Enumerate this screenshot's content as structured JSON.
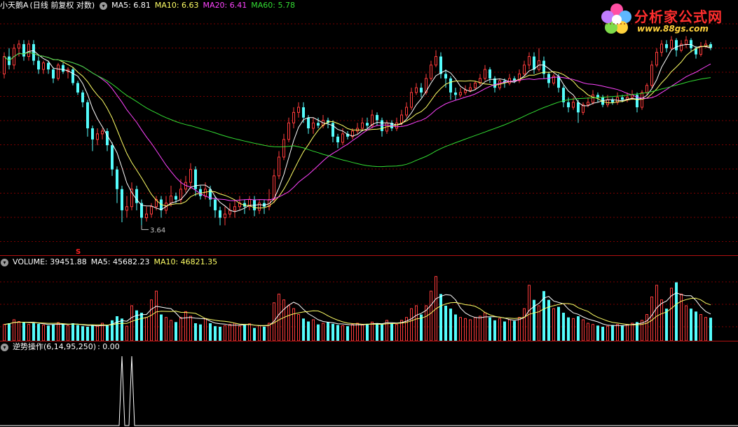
{
  "main_header": {
    "name": "小天鹅A",
    "mode": "(日线 前复权 对数)",
    "ma5": "MA5: 6.81",
    "ma10": "MA10: 6.63",
    "ma20": "MA20: 6.41",
    "ma60": "MA60: 5.78"
  },
  "volume_header": {
    "volume": "VOLUME: 39451.88",
    "ma5": "MA5: 45682.23",
    "ma10": "MA10: 46821.35"
  },
  "indicator_header": {
    "label": "逆势操作(6,14,95,250)",
    "value": ": 0.00"
  },
  "annotations": {
    "low_label": "3.64",
    "signal_mark": "S"
  },
  "logo": {
    "title": "分析家公式网",
    "url": "www.88gs.com"
  },
  "colors": {
    "up": "#ff3b3b",
    "down": "#54fcfc",
    "ma5": "#ffffff",
    "ma10": "#ffff66",
    "ma20": "#ff44ff",
    "ma60": "#33dd33",
    "grid": "#7a0000",
    "indicator": "#ffffff"
  },
  "chart_data": [
    {
      "type": "candlestick",
      "title": "小天鹅A (日线 前复权 对数)",
      "scale": "log",
      "ylim": [
        3.3,
        7.2
      ],
      "grid": true,
      "series_labels": [
        "MA5",
        "MA10",
        "MA20",
        "MA60"
      ],
      "last_values": {
        "MA5": 6.81,
        "MA10": 6.63,
        "MA20": 6.41,
        "MA60": 5.78
      },
      "annotated_low": 3.64,
      "candles": [
        [
          6.2,
          6.6,
          6.7,
          6.1
        ],
        [
          6.6,
          6.4,
          6.8,
          6.3
        ],
        [
          6.4,
          6.8,
          6.9,
          6.3
        ],
        [
          6.8,
          6.9,
          7.0,
          6.6
        ],
        [
          6.9,
          6.6,
          7.0,
          6.5
        ],
        [
          6.6,
          6.9,
          7.0,
          6.5
        ],
        [
          6.9,
          6.5,
          7.0,
          6.4
        ],
        [
          6.5,
          6.3,
          6.6,
          6.2
        ],
        [
          6.3,
          6.45,
          6.5,
          6.2
        ],
        [
          6.45,
          6.3,
          6.5,
          6.2
        ],
        [
          6.3,
          6.1,
          6.35,
          6.0
        ],
        [
          6.1,
          6.4,
          6.45,
          6.05
        ],
        [
          6.4,
          6.25,
          6.45,
          6.2
        ],
        [
          6.25,
          6.3,
          6.35,
          6.1
        ],
        [
          6.3,
          6.0,
          6.35,
          5.95
        ],
        [
          6.0,
          5.8,
          6.05,
          5.75
        ],
        [
          5.8,
          5.6,
          5.85,
          5.5
        ],
        [
          5.6,
          5.1,
          5.65,
          4.95
        ],
        [
          5.1,
          4.9,
          5.15,
          4.7
        ],
        [
          4.9,
          5.0,
          5.1,
          4.8
        ],
        [
          5.0,
          5.05,
          5.1,
          4.9
        ],
        [
          5.05,
          4.8,
          5.1,
          4.7
        ],
        [
          4.8,
          4.4,
          4.85,
          4.3
        ],
        [
          4.4,
          4.1,
          4.45,
          3.9
        ],
        [
          4.1,
          3.8,
          4.15,
          3.64
        ],
        [
          3.8,
          3.85,
          4.0,
          3.7
        ],
        [
          3.85,
          4.1,
          4.2,
          3.8
        ],
        [
          4.1,
          3.9,
          4.15,
          3.8
        ],
        [
          3.9,
          3.7,
          3.95,
          3.6
        ],
        [
          3.7,
          3.75,
          3.85,
          3.65
        ],
        [
          3.75,
          3.85,
          3.9,
          3.7
        ],
        [
          3.85,
          3.95,
          4.0,
          3.8
        ],
        [
          3.95,
          3.8,
          4.0,
          3.7
        ],
        [
          3.8,
          3.9,
          4.0,
          3.75
        ],
        [
          3.9,
          4.0,
          4.15,
          3.85
        ],
        [
          4.0,
          3.95,
          4.05,
          3.9
        ],
        [
          3.95,
          4.1,
          4.25,
          3.9
        ],
        [
          4.1,
          4.2,
          4.3,
          4.05
        ],
        [
          4.2,
          4.4,
          4.5,
          4.1
        ],
        [
          4.4,
          4.1,
          4.45,
          4.0
        ],
        [
          4.1,
          4.0,
          4.15,
          3.95
        ],
        [
          4.0,
          4.1,
          4.2,
          3.95
        ],
        [
          4.1,
          3.95,
          4.15,
          3.85
        ],
        [
          3.95,
          3.8,
          4.0,
          3.7
        ],
        [
          3.8,
          3.7,
          3.85,
          3.6
        ],
        [
          3.7,
          3.75,
          3.85,
          3.6
        ],
        [
          3.75,
          3.8,
          3.9,
          3.7
        ],
        [
          3.8,
          3.85,
          3.95,
          3.7
        ],
        [
          3.85,
          3.9,
          4.0,
          3.8
        ],
        [
          3.9,
          3.85,
          3.95,
          3.75
        ],
        [
          3.85,
          3.95,
          4.0,
          3.8
        ],
        [
          3.95,
          3.8,
          4.0,
          3.72
        ],
        [
          3.8,
          3.9,
          3.95,
          3.75
        ],
        [
          3.9,
          3.85,
          3.95,
          3.75
        ],
        [
          3.85,
          3.95,
          4.1,
          3.8
        ],
        [
          3.95,
          4.3,
          4.4,
          3.9
        ],
        [
          4.3,
          4.6,
          4.7,
          4.25
        ],
        [
          4.6,
          4.9,
          5.0,
          4.55
        ],
        [
          4.9,
          5.2,
          5.3,
          4.85
        ],
        [
          5.2,
          5.4,
          5.5,
          5.1
        ],
        [
          5.4,
          5.5,
          5.6,
          5.3
        ],
        [
          5.5,
          5.3,
          5.6,
          5.2
        ],
        [
          5.3,
          5.1,
          5.35,
          5.0
        ],
        [
          5.1,
          5.2,
          5.3,
          5.0
        ],
        [
          5.2,
          5.15,
          5.3,
          5.1
        ],
        [
          5.15,
          5.25,
          5.35,
          5.1
        ],
        [
          5.25,
          5.2,
          5.3,
          5.1
        ],
        [
          5.2,
          4.95,
          5.25,
          4.85
        ],
        [
          4.95,
          4.85,
          5.0,
          4.75
        ],
        [
          4.85,
          5.0,
          5.1,
          4.8
        ],
        [
          5.0,
          4.95,
          5.05,
          4.9
        ],
        [
          4.95,
          5.05,
          5.1,
          4.9
        ],
        [
          5.05,
          5.1,
          5.2,
          5.0
        ],
        [
          5.1,
          5.2,
          5.3,
          5.05
        ],
        [
          5.2,
          5.15,
          5.3,
          5.1
        ],
        [
          5.15,
          5.35,
          5.45,
          5.1
        ],
        [
          5.35,
          5.25,
          5.4,
          5.15
        ],
        [
          5.25,
          5.05,
          5.3,
          4.95
        ],
        [
          5.05,
          5.2,
          5.25,
          5.0
        ],
        [
          5.2,
          5.1,
          5.25,
          5.05
        ],
        [
          5.1,
          5.2,
          5.3,
          5.05
        ],
        [
          5.2,
          5.35,
          5.45,
          5.15
        ],
        [
          5.35,
          5.5,
          5.6,
          5.3
        ],
        [
          5.5,
          5.8,
          5.9,
          5.45
        ],
        [
          5.8,
          5.9,
          6.0,
          5.75
        ],
        [
          5.9,
          5.8,
          6.0,
          5.7
        ],
        [
          5.8,
          6.1,
          6.2,
          5.75
        ],
        [
          6.1,
          6.4,
          6.5,
          6.05
        ],
        [
          6.4,
          6.6,
          6.75,
          6.35
        ],
        [
          6.6,
          6.2,
          6.7,
          6.1
        ],
        [
          6.2,
          6.1,
          6.3,
          5.9
        ],
        [
          6.1,
          5.8,
          6.15,
          5.65
        ],
        [
          5.8,
          5.75,
          5.9,
          5.65
        ],
        [
          5.75,
          5.8,
          5.9,
          5.7
        ],
        [
          5.8,
          5.85,
          5.95,
          5.75
        ],
        [
          5.85,
          5.9,
          6.0,
          5.8
        ],
        [
          5.9,
          6.0,
          6.05,
          5.85
        ],
        [
          6.0,
          6.1,
          6.2,
          5.95
        ],
        [
          6.1,
          6.3,
          6.4,
          6.05
        ],
        [
          6.3,
          6.1,
          6.35,
          6.0
        ],
        [
          6.1,
          5.9,
          6.15,
          5.8
        ],
        [
          5.9,
          6.05,
          6.1,
          5.85
        ],
        [
          6.05,
          6.0,
          6.1,
          5.9
        ],
        [
          6.0,
          6.1,
          6.2,
          5.95
        ],
        [
          6.1,
          6.05,
          6.15,
          6.0
        ],
        [
          6.05,
          6.2,
          6.3,
          6.0
        ],
        [
          6.2,
          6.4,
          6.5,
          6.15
        ],
        [
          6.4,
          6.6,
          6.7,
          6.3
        ],
        [
          6.6,
          6.3,
          6.7,
          6.2
        ],
        [
          6.3,
          6.5,
          6.8,
          6.25
        ],
        [
          6.5,
          6.2,
          6.6,
          6.1
        ],
        [
          6.2,
          6.0,
          6.25,
          5.9
        ],
        [
          6.0,
          6.15,
          6.2,
          5.95
        ],
        [
          6.15,
          5.9,
          6.2,
          5.8
        ],
        [
          5.9,
          5.6,
          5.95,
          5.5
        ],
        [
          5.6,
          5.5,
          5.7,
          5.4
        ],
        [
          5.5,
          5.6,
          5.7,
          5.45
        ],
        [
          5.6,
          5.4,
          5.65,
          5.2
        ],
        [
          5.4,
          5.55,
          5.6,
          5.35
        ],
        [
          5.55,
          5.6,
          5.7,
          5.5
        ],
        [
          5.6,
          5.75,
          5.85,
          5.55
        ],
        [
          5.75,
          5.7,
          5.8,
          5.6
        ],
        [
          5.7,
          5.55,
          5.75,
          5.5
        ],
        [
          5.55,
          5.65,
          5.75,
          5.5
        ],
        [
          5.65,
          5.6,
          5.7,
          5.55
        ],
        [
          5.6,
          5.7,
          5.8,
          5.55
        ],
        [
          5.7,
          5.65,
          5.75,
          5.6
        ],
        [
          5.65,
          5.7,
          5.8,
          5.6
        ],
        [
          5.7,
          5.75,
          5.85,
          5.65
        ],
        [
          5.75,
          5.5,
          5.8,
          5.4
        ],
        [
          5.5,
          5.8,
          5.85,
          5.45
        ],
        [
          5.8,
          5.95,
          6.0,
          5.75
        ],
        [
          5.95,
          6.4,
          6.5,
          5.9
        ],
        [
          6.4,
          6.7,
          6.8,
          6.35
        ],
        [
          6.7,
          6.9,
          7.0,
          6.6
        ],
        [
          6.9,
          6.8,
          7.0,
          6.7
        ],
        [
          6.8,
          7.0,
          7.1,
          6.75
        ],
        [
          7.0,
          6.75,
          7.05,
          6.6
        ],
        [
          6.75,
          6.9,
          7.0,
          6.7
        ],
        [
          6.9,
          7.0,
          7.1,
          6.8
        ],
        [
          7.0,
          6.8,
          7.05,
          6.7
        ],
        [
          6.8,
          6.65,
          6.85,
          6.55
        ],
        [
          6.65,
          6.85,
          6.95,
          6.6
        ],
        [
          6.85,
          6.9,
          7.0,
          6.8
        ],
        [
          6.9,
          6.81,
          6.95,
          6.75
        ]
      ]
    },
    {
      "type": "bar",
      "title": "VOLUME",
      "series_labels": [
        "VOLUME",
        "MA5",
        "MA10"
      ],
      "last_values": {
        "VOLUME": 39451.88,
        "MA5": 45682.23,
        "MA10": 46821.35
      },
      "ylim": [
        0,
        120000
      ],
      "values": [
        28000,
        30000,
        36000,
        33000,
        32000,
        28000,
        30000,
        29000,
        27000,
        26000,
        28000,
        31000,
        29000,
        26000,
        30000,
        27000,
        25000,
        24000,
        26000,
        25000,
        30000,
        27000,
        35000,
        42000,
        38000,
        25000,
        60000,
        52000,
        48000,
        40000,
        70000,
        85000,
        45000,
        40000,
        35000,
        32000,
        40000,
        50000,
        42000,
        30000,
        28000,
        38000,
        30000,
        25000,
        24000,
        26000,
        28000,
        30000,
        25000,
        27000,
        29000,
        22000,
        26000,
        24000,
        30000,
        65000,
        80000,
        70000,
        60000,
        55000,
        45000,
        38000,
        33000,
        36000,
        28000,
        30000,
        32000,
        29000,
        27000,
        26000,
        25000,
        28000,
        30000,
        27000,
        29000,
        32000,
        30000,
        28000,
        35000,
        30000,
        28000,
        35000,
        40000,
        55000,
        60000,
        45000,
        60000,
        85000,
        110000,
        80000,
        60000,
        55000,
        45000,
        40000,
        38000,
        36000,
        40000,
        42000,
        48000,
        40000,
        35000,
        38000,
        33000,
        36000,
        34000,
        40000,
        55000,
        95000,
        70000,
        60000,
        85000,
        70000,
        55000,
        58000,
        48000,
        40000,
        38000,
        42000,
        36000,
        30000,
        28000,
        26000,
        24000,
        25000,
        27000,
        28000,
        26000,
        28000,
        30000,
        32000,
        35000,
        45000,
        75000,
        95000,
        70000,
        55000,
        90000,
        100000,
        80000,
        60000,
        55000,
        50000,
        45000,
        40000,
        39451.88
      ]
    },
    {
      "type": "line",
      "title": "逆势操作(6,14,95,250)",
      "last_value": 0.0,
      "signal_candles": [
        24,
        26
      ],
      "ylim": [
        0,
        1
      ]
    }
  ]
}
